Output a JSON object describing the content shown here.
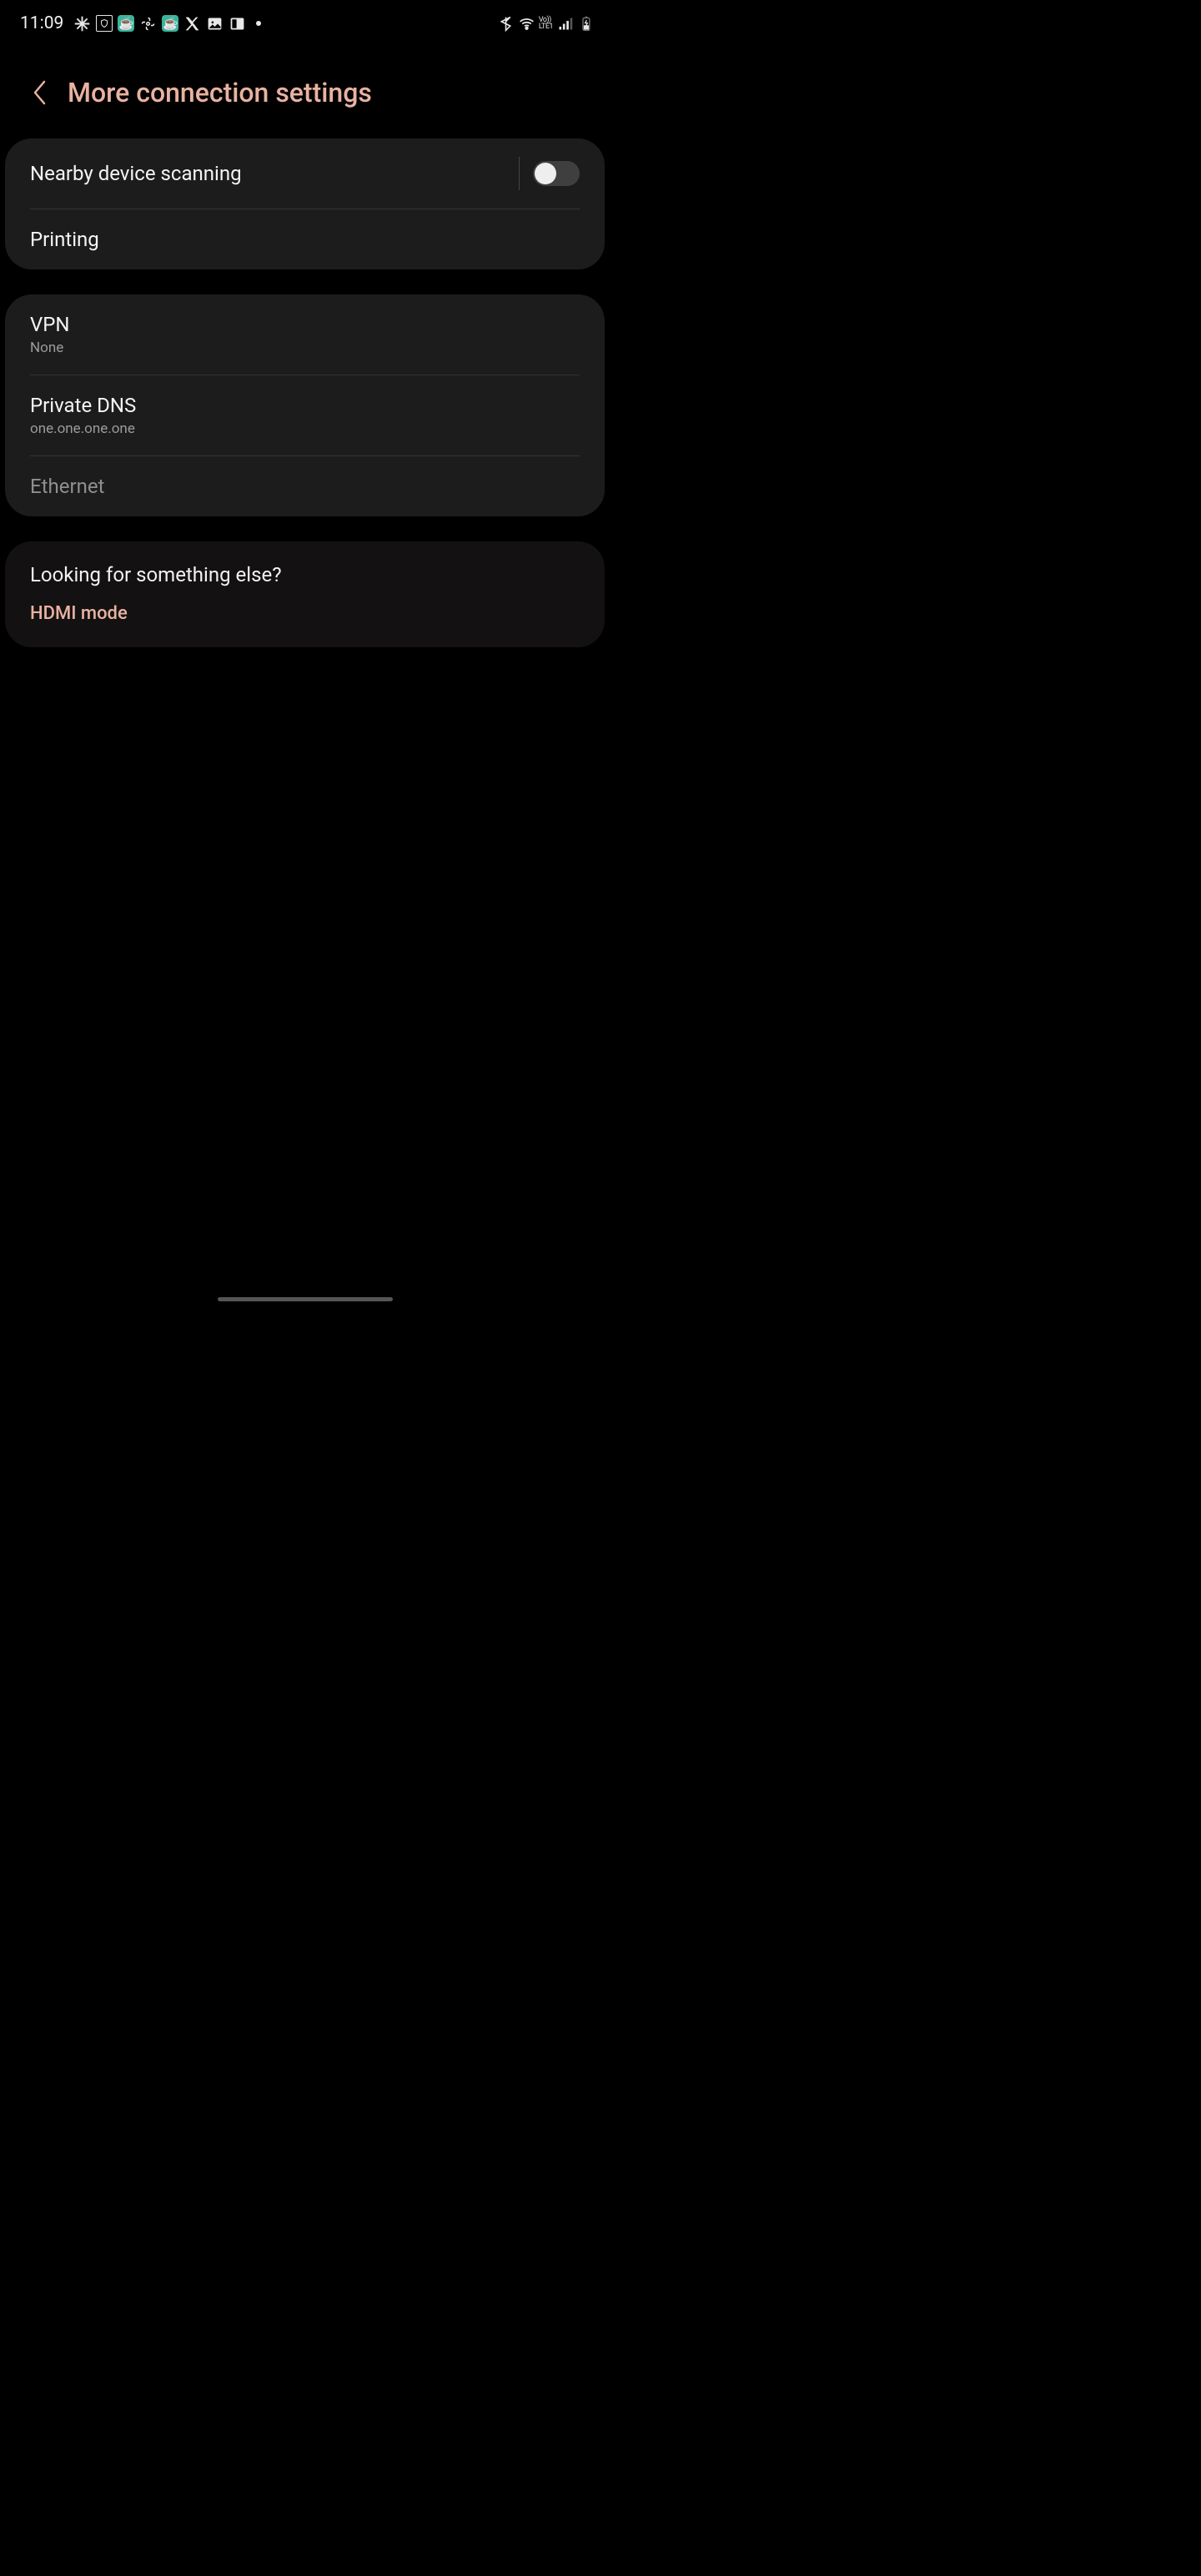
{
  "status": {
    "time": "11:09",
    "lte": "LTE1",
    "vo": "Vo))"
  },
  "header": {
    "title": "More connection settings"
  },
  "group1": {
    "nearby": "Nearby device scanning",
    "printing": "Printing"
  },
  "group2": {
    "vpn_title": "VPN",
    "vpn_sub": "None",
    "dns_title": "Private DNS",
    "dns_sub": "one.one.one.one",
    "ethernet": "Ethernet"
  },
  "looking": {
    "title": "Looking for something else?",
    "link": "HDMI mode"
  }
}
